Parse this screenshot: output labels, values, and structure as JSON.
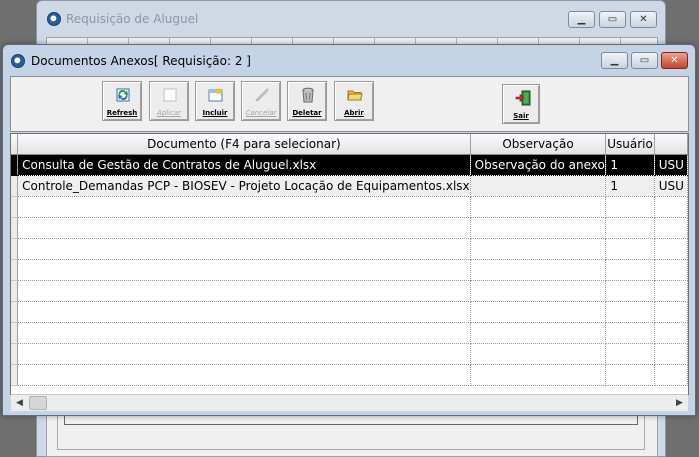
{
  "background_window": {
    "title": "Requisição de Aluguel"
  },
  "dialog": {
    "title": "Documentos Anexos[ Requisição: 2 ]",
    "controls": {
      "minimize": "–",
      "maximize": "▭",
      "close": "✕"
    }
  },
  "toolbar": {
    "refresh": "Refresh",
    "apply": "Aplicar",
    "include": "Incluir",
    "cancel": "Cancelar",
    "delete": "Deletar",
    "open": "Abrir",
    "exit": "Sair"
  },
  "grid": {
    "columns": [
      "Documento (F4 para selecionar)",
      "Observação",
      "Usuário"
    ],
    "rows": [
      {
        "documento": "Consulta de Gestão de Contratos de Aluguel.xlsx",
        "observacao": "Observação do anexo",
        "usuario": "1",
        "extra": "USU"
      },
      {
        "documento": "Controle_Demandas PCP - BIOSEV - Projeto Locação de Equipamentos.xlsx",
        "observacao": "",
        "usuario": "1",
        "extra": "USU"
      }
    ]
  },
  "colors": {
    "selected_row": "#000000",
    "titlebar": "#c4d3e6",
    "close_button": "#c4442a"
  }
}
